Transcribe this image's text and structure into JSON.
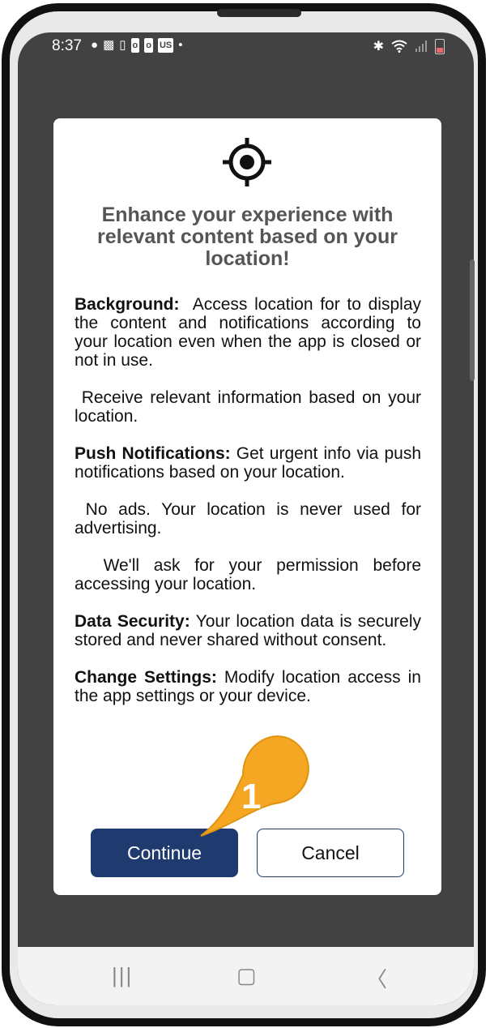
{
  "status_bar": {
    "time": "8:37",
    "left_icons": [
      "chat-bubble-icon",
      "teams-icon",
      "sim-alert-icon",
      "outlook-icon",
      "outlook-icon",
      "us-app-icon",
      "dot-icon"
    ],
    "right_icons": [
      "bluetooth-icon",
      "wifi-icon",
      "signal-icon",
      "battery-icon"
    ],
    "us_badge": "US"
  },
  "dialog": {
    "icon": "location-target-icon",
    "title": "Enhance your experience with relevant content based on your location!",
    "paragraphs": [
      {
        "label": "Background:",
        "text": "  Access location for to display the content and notifications according to your location even when the app is closed or not in use."
      },
      {
        "label": "",
        "text": " Receive relevant information based on your location."
      },
      {
        "label": "Push Notifications:",
        "text": " Get urgent info via push notifications based on your location."
      },
      {
        "label": "",
        "text": " No ads. Your location is never used for advertising."
      },
      {
        "label": "",
        "text": "  We'll ask for your permission before accessing your location."
      },
      {
        "label": "Data Security:",
        "text": " Your location data is securely stored and never shared without consent."
      },
      {
        "label": "Change Settings:",
        "text": " Modify location access in the app settings or your device."
      }
    ],
    "continue_label": "Continue",
    "cancel_label": "Cancel"
  },
  "callout": {
    "number": "1",
    "color": "#f5a623"
  },
  "nav_bar": {
    "recents": "|||",
    "home": "▢",
    "back": "〈"
  },
  "colors": {
    "primary": "#1e3a6e",
    "scrim": "#424242"
  }
}
